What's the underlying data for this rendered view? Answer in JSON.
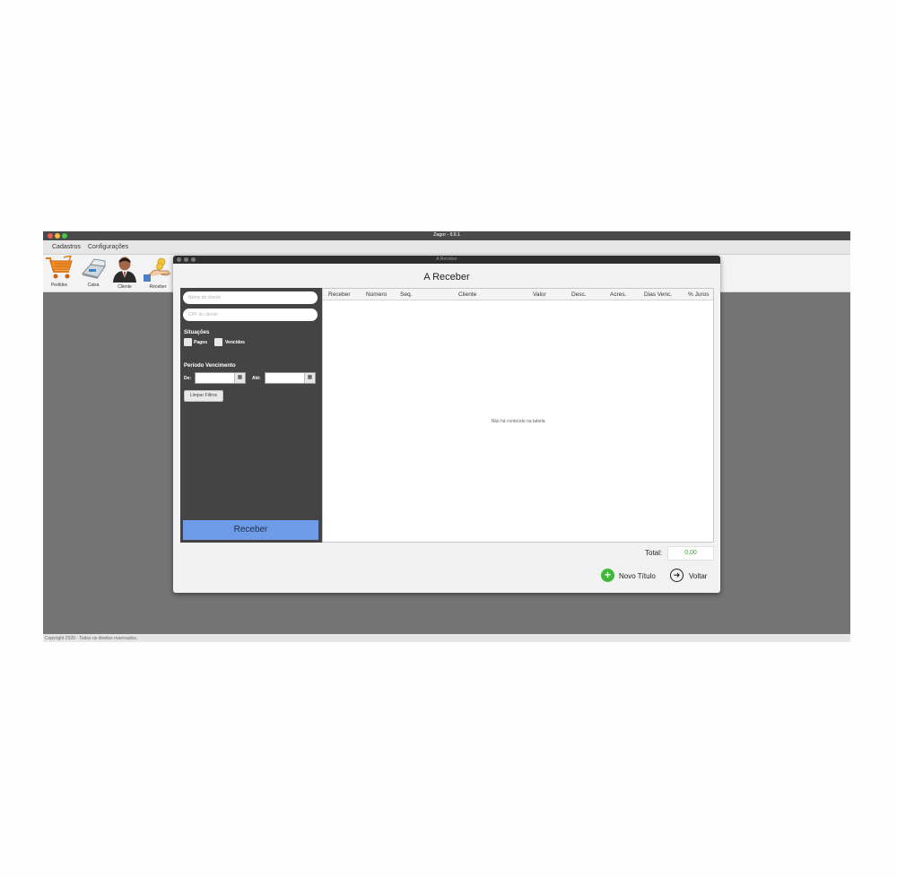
{
  "app": {
    "title": "Zagor - 0.0.1",
    "menu": [
      "Cadastros",
      "Configurações"
    ],
    "toolbar": [
      {
        "label": "Pedidos",
        "icon": "shopping-cart-icon"
      },
      {
        "label": "Caixa",
        "icon": "cash-register-icon"
      },
      {
        "label": "Cliente",
        "icon": "customer-icon"
      },
      {
        "label": "Receber",
        "icon": "receive-payment-icon"
      }
    ],
    "copyright": "Copyright 2020 - Todos os direitos reservados."
  },
  "dialog": {
    "window_title": "A Receber",
    "heading": "A Receber",
    "filters": {
      "client_name_placeholder": "Nome do cliente",
      "client_cpf_placeholder": "CPF do cliente",
      "situations_title": "Situações",
      "situations": [
        "Pagos",
        "Vencidos"
      ],
      "period_title": "Período Vencimento",
      "from_label": "De:",
      "to_label": "Até:",
      "clear_button": "Limpar Filtros",
      "receive_button": "Receber"
    },
    "table": {
      "columns": [
        "Receber",
        "Número",
        "Seq.",
        "Cliente",
        "Valor",
        "Desc.",
        "Acres.",
        "Dias Venc.",
        "% Juros"
      ],
      "empty_message": "Não há conteúdo na tabela"
    },
    "total_label": "Total:",
    "total_value": "0,00",
    "new_title_button": "Novo Título",
    "back_button": "Voltar"
  },
  "colors": {
    "app_background": "#747474",
    "filter_panel": "#444444",
    "receive_button": "#6f9ce8",
    "new_title_icon": "#3fb93a",
    "total_value": "#3aa33a"
  }
}
